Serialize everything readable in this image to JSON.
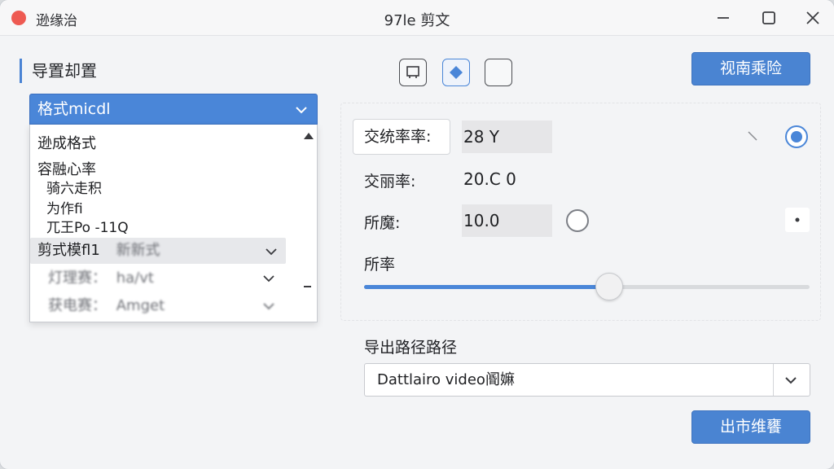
{
  "titlebar": {
    "app_name": "逊缘治",
    "title": "97le 剪文"
  },
  "section": {
    "title": "导置却置"
  },
  "format_dropdown": {
    "selected": "格式micdl",
    "items": [
      {
        "label": "逊成格式"
      },
      {
        "label": "容融心率"
      },
      {
        "label": "骑六走积"
      },
      {
        "label": "为作fi"
      },
      {
        "label": "兀王Po -11Q"
      }
    ],
    "rows": [
      {
        "label": "剪式模fl1",
        "value": "新新式"
      },
      {
        "label": "灯理赛：",
        "value": "ha/vt"
      },
      {
        "label": "获电赛：",
        "value": "Amget"
      }
    ]
  },
  "toolbar": {
    "top_right_button": "视南乘险"
  },
  "settings": {
    "bitrate_label": "交统率率:",
    "bitrate_value": "28 Y",
    "rate_label": "交丽率:",
    "rate_value": "20.C 0",
    "quality_label": "所魔:",
    "quality_value": "10.0",
    "slider_label": "所率",
    "slider_level": 0.55
  },
  "export": {
    "path_label": "导出路径路径",
    "path_value": "Dattlairo video阍嫲"
  },
  "footer": {
    "export_button": "出市维饔"
  },
  "colors": {
    "accent": "#4a86d8",
    "close": "#ee5a52"
  }
}
